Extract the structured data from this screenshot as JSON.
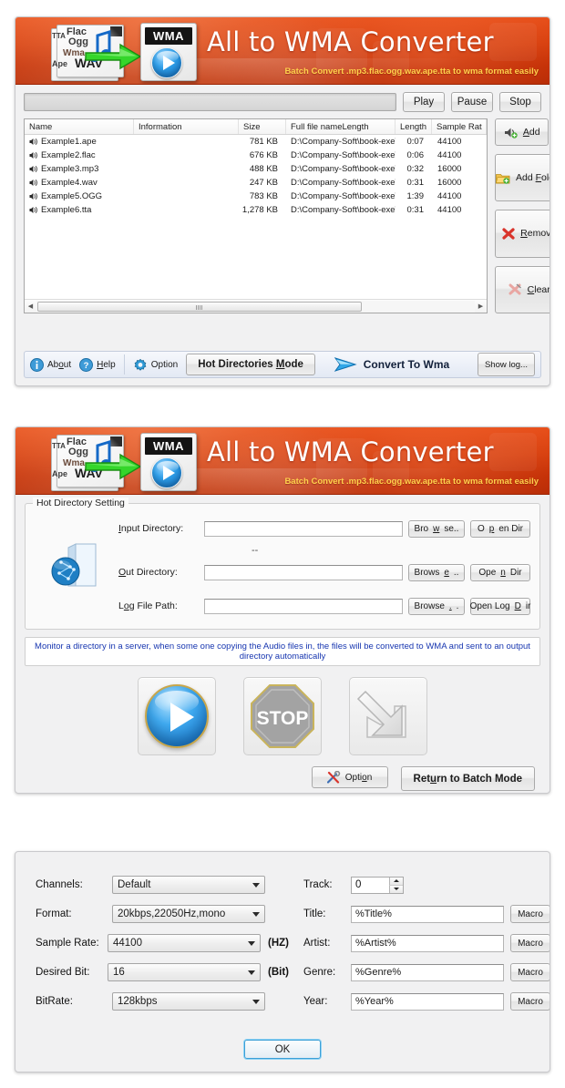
{
  "app": {
    "title": "All to WMA Converter",
    "subtitle": "Batch Convert  .mp3.flac.ogg.wav.ape.tta to wma  format easily",
    "logo": {
      "wma_label": "WMA",
      "source_formats": [
        "TTA",
        "Flac",
        "Ogg",
        "Wma",
        "Ape",
        "WAV"
      ]
    },
    "accent_color": "#d8400f",
    "title_color": "#ffffff",
    "subtitle_color": "#ffd24d"
  },
  "batch_window": {
    "player": {
      "play_label": "Play",
      "pause_label": "Pause",
      "stop_label": "Stop",
      "progress_value": 0
    },
    "file_list": {
      "columns": [
        "Name",
        "Information",
        "Size",
        "Full file nameLength",
        "Length",
        "Sample Rat"
      ],
      "rows": [
        {
          "name": "Example1.ape",
          "information": "",
          "size": "781 KB",
          "full_path": "D:\\Company-Soft\\book-exe\\Box...",
          "length": "0:07",
          "sample_rate": "44100"
        },
        {
          "name": "Example2.flac",
          "information": "",
          "size": "676 KB",
          "full_path": "D:\\Company-Soft\\book-exe\\Box...",
          "length": "0:06",
          "sample_rate": "44100"
        },
        {
          "name": "Example3.mp3",
          "information": "",
          "size": "488 KB",
          "full_path": "D:\\Company-Soft\\book-exe\\Box...",
          "length": "0:32",
          "sample_rate": "16000"
        },
        {
          "name": "Example4.wav",
          "information": "",
          "size": "247 KB",
          "full_path": "D:\\Company-Soft\\book-exe\\Box...",
          "length": "0:31",
          "sample_rate": "16000"
        },
        {
          "name": "Example5.OGG",
          "information": "",
          "size": "783 KB",
          "full_path": "D:\\Company-Soft\\book-exe\\Box...",
          "length": "1:39",
          "sample_rate": "44100"
        },
        {
          "name": "Example6.tta",
          "information": "",
          "size": "1,278 KB",
          "full_path": "D:\\Company-Soft\\book-exe\\Box...",
          "length": "0:31",
          "sample_rate": "44100"
        }
      ]
    },
    "side_buttons": {
      "add_label": "Add",
      "add_folder_label": "Add Folder",
      "remove_label": "Remove",
      "clear_label": "Clear"
    },
    "footer": {
      "about_label": "About",
      "help_label": "Help",
      "option_label": "Option",
      "hot_directories_label": "Hot Directories Mode",
      "convert_label": "Convert To Wma",
      "show_log_label": "Show log..."
    }
  },
  "hotdir_window": {
    "group_legend": "Hot Directory Setting",
    "separator_glyph": "--",
    "fields": [
      {
        "label": "Input Directory:",
        "value": "",
        "browse_label": "Browse..",
        "open_label": "Open Dir"
      },
      {
        "label": "Out Directory:",
        "value": "",
        "browse_label": "Browse..",
        "open_label": "Open Dir"
      },
      {
        "label": "Log File Path:",
        "value": "",
        "browse_label": "Browse..",
        "open_label": "Open LogDir"
      }
    ],
    "notice": "Monitor a directory in a server, when some one copying the Audio files in, the files will be converted to WMA and sent to an output directory automatically",
    "notice_color": "#1736b0",
    "big_buttons": [
      "start-play-icon",
      "stop-sign-icon",
      "output-arrow-icon"
    ],
    "stop_label": "STOP",
    "option_label": "Option",
    "return_label": "Return to Batch Mode"
  },
  "settings_window": {
    "audio": [
      {
        "label": "Channels:",
        "value": "Default",
        "unit": ""
      },
      {
        "label": "Format:",
        "value": "20kbps,22050Hz,mono",
        "unit": ""
      },
      {
        "label": "Sample Rate:",
        "value": "44100",
        "unit": "(HZ)"
      },
      {
        "label": "Desired Bit:",
        "value": "16",
        "unit": "(Bit)"
      },
      {
        "label": "BitRate:",
        "value": "128kbps",
        "unit": ""
      }
    ],
    "track": {
      "label": "Track:",
      "value": "0"
    },
    "meta": [
      {
        "label": "Title:",
        "value": "%Title%",
        "macro_label": "Macro"
      },
      {
        "label": "Artist:",
        "value": "%Artist%",
        "macro_label": "Macro"
      },
      {
        "label": "Genre:",
        "value": "%Genre%",
        "macro_label": "Macro"
      },
      {
        "label": "Year:",
        "value": "%Year%",
        "macro_label": "Macro"
      }
    ],
    "ok_label": "OK"
  }
}
